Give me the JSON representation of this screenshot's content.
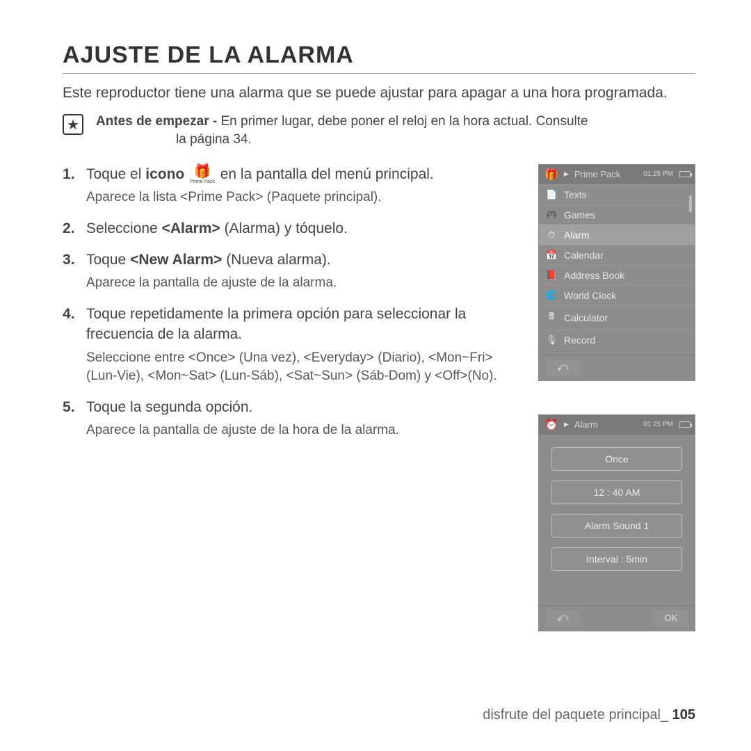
{
  "heading": "AJUSTE DE LA ALARMA",
  "intro": "Este reproductor tiene una alarma que se puede ajustar para apagar a una hora programada.",
  "note": {
    "lead": "Antes de empezar -",
    "body": " En primer lugar, debe poner el reloj en la hora actual. Consulte",
    "cont": "la página 34."
  },
  "inline_icon_label": "Prime Pack",
  "steps": [
    {
      "pre": "Toque el ",
      "bold": "icono",
      "post": " en la pantalla del menú principal.",
      "sub": "Aparece la lista <Prime Pack> (Paquete principal)."
    },
    {
      "text_html": "Seleccione <b><Alarm></b> (Alarma) y tóquelo."
    },
    {
      "text_html": "Toque <b><New Alarm></b> (Nueva alarma).",
      "sub": "Aparece la pantalla de ajuste de la alarma."
    },
    {
      "text": "Toque repetidamente la primera opción para seleccionar la frecuencia de la alarma.",
      "sub": "Seleccione entre <Once> (Una vez), <Everyday> (Diario), <Mon~Fri> (Lun-Vie), <Mon~Sat> (Lun-Sáb), <Sat~Sun> (Sáb-Dom) y <Off>(No)."
    },
    {
      "text": "Toque la segunda opción.",
      "sub": "Aparece la pantalla de ajuste de la hora de la alarma."
    }
  ],
  "screen1": {
    "title": "Prime Pack",
    "time": "01:25 PM",
    "items": [
      {
        "icon": "📄",
        "label": "Texts"
      },
      {
        "icon": "🎮",
        "label": "Games"
      },
      {
        "icon": "⏱",
        "label": "Alarm",
        "selected": true
      },
      {
        "icon": "📅",
        "label": "Calendar"
      },
      {
        "icon": "📕",
        "label": "Address Book"
      },
      {
        "icon": "🌐",
        "label": "World Clock"
      },
      {
        "icon": "🖩",
        "label": "Calculator"
      },
      {
        "icon": "🎙",
        "label": "Record"
      }
    ]
  },
  "screen2": {
    "title": "Alarm",
    "time": "01:25 PM",
    "options": {
      "freq": "Once",
      "time_val": "12 : 40 AM",
      "sound": "Alarm Sound 1",
      "interval": "Interval : 5min"
    },
    "ok": "OK"
  },
  "footer": {
    "text": "disfrute del paquete principal_",
    "page": "105"
  }
}
